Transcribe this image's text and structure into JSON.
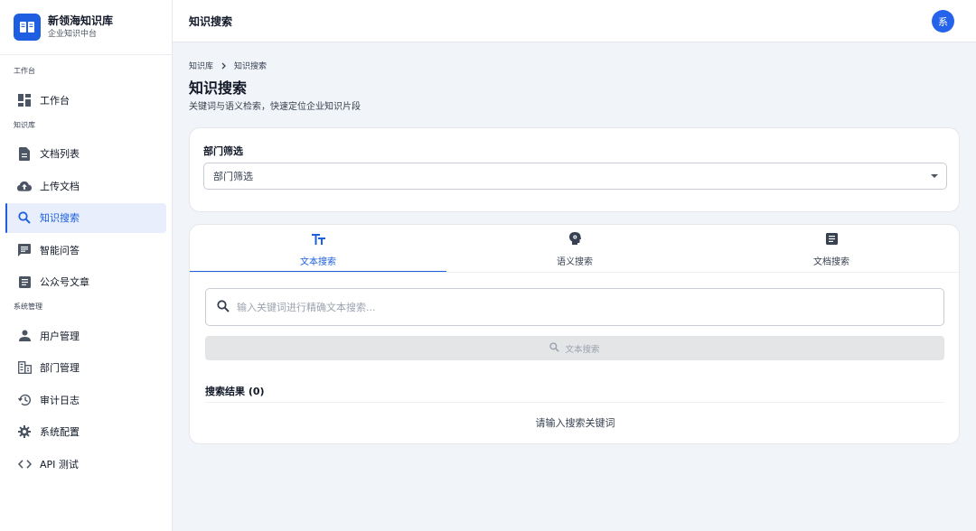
{
  "brand": {
    "title": "新领海知识库",
    "subtitle": "企业知识中台"
  },
  "sidebar": {
    "sections": [
      {
        "label": "工作台",
        "items": [
          {
            "label": "工作台",
            "icon": "dashboard-icon"
          }
        ]
      },
      {
        "label": "知识库",
        "items": [
          {
            "label": "文档列表",
            "icon": "document-icon"
          },
          {
            "label": "上传文档",
            "icon": "cloud-upload-icon"
          },
          {
            "label": "知识搜索",
            "icon": "search-icon",
            "active": true
          },
          {
            "label": "智能问答",
            "icon": "chat-icon"
          },
          {
            "label": "公众号文章",
            "icon": "article-icon"
          }
        ]
      },
      {
        "label": "系统管理",
        "items": [
          {
            "label": "用户管理",
            "icon": "person-icon"
          },
          {
            "label": "部门管理",
            "icon": "building-icon"
          },
          {
            "label": "审计日志",
            "icon": "history-icon"
          },
          {
            "label": "系统配置",
            "icon": "gear-icon"
          },
          {
            "label": "API 测试",
            "icon": "code-icon"
          }
        ]
      }
    ]
  },
  "header": {
    "title": "知识搜索",
    "avatar": "系"
  },
  "breadcrumb": [
    "知识库",
    "知识搜索"
  ],
  "page": {
    "title": "知识搜索",
    "subtitle": "关键词与语义检索，快速定位企业知识片段"
  },
  "filter": {
    "label": "部门筛选",
    "value": "部门筛选"
  },
  "tabs": [
    {
      "label": "文本搜索",
      "icon": "text-fields-icon",
      "active": true
    },
    {
      "label": "语义搜索",
      "icon": "psychology-icon"
    },
    {
      "label": "文档搜索",
      "icon": "article-icon"
    }
  ],
  "search": {
    "placeholder": "输入关键词进行精确文本搜索...",
    "button_label": "文本搜索"
  },
  "results": {
    "title": "搜索结果 (0)",
    "empty_text": "请输入搜索关键词"
  },
  "colors": {
    "accent": "#1d5fe0",
    "avatar": "#2563eb",
    "background": "#f1f4f8"
  }
}
